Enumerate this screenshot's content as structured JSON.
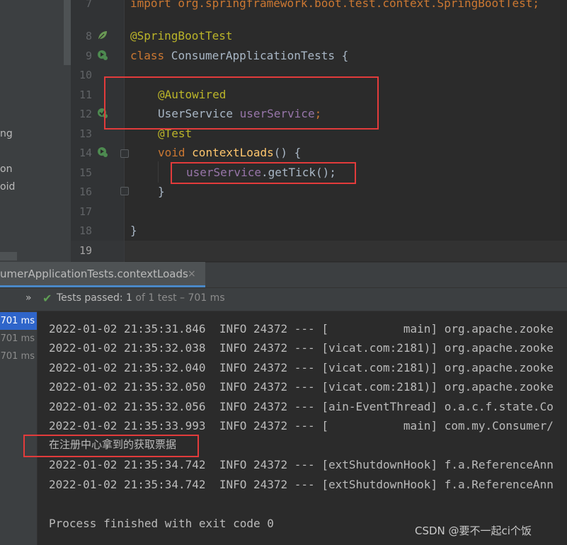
{
  "left_panel": {
    "items": [
      "ng",
      "on",
      "oid"
    ]
  },
  "editor": {
    "lines": [
      {
        "num": "7",
        "text": "import org.springframework.boot.test.context.SpringBootTest;"
      },
      {
        "num": "8",
        "text": "@SpringBootTest"
      },
      {
        "num": "9",
        "kw": "class",
        "rest": " ConsumerApplicationTests {"
      },
      {
        "num": "10"
      },
      {
        "num": "11",
        "text": "@Autowired"
      },
      {
        "num": "12",
        "type": "UserService",
        "field": "userService",
        "end": ";"
      },
      {
        "num": "13",
        "text": "@Test"
      },
      {
        "num": "14",
        "kw": "void",
        "fn": "contextLoads",
        "rest": "() {"
      },
      {
        "num": "15",
        "obj": "userService",
        "rest": ".getTick();"
      },
      {
        "num": "16",
        "text": "}"
      },
      {
        "num": "17"
      },
      {
        "num": "18",
        "text": "}"
      },
      {
        "num": "19"
      }
    ]
  },
  "run_window": {
    "tab_label": "umerApplicationTests.contextLoads",
    "close_glyph": "×",
    "status": {
      "chevrons": "»",
      "check": "✔",
      "passed": "Tests passed: ",
      "count": "1",
      "detail": " of 1 test – 701 ms"
    },
    "tree_times": [
      "701 ms",
      "701 ms",
      "701 ms"
    ],
    "console_lines": [
      "2022-01-02 21:35:31.846  INFO 24372 --- [           main] org.apache.zooke",
      "2022-01-02 21:35:32.038  INFO 24372 --- [vicat.com:2181)] org.apache.zooke",
      "2022-01-02 21:35:32.040  INFO 24372 --- [vicat.com:2181)] org.apache.zooke",
      "2022-01-02 21:35:32.050  INFO 24372 --- [vicat.com:2181)] org.apache.zooke",
      "2022-01-02 21:35:32.056  INFO 24372 --- [ain-EventThread] o.a.c.f.state.Co",
      "2022-01-02 21:35:33.993  INFO 24372 --- [           main] com.my.Consumer/",
      "在注册中心拿到的获取票据",
      "2022-01-02 21:35:34.742  INFO 24372 --- [extShutdownHook] f.a.ReferenceAnn",
      "2022-01-02 21:35:34.742  INFO 24372 --- [extShutdownHook] f.a.ReferenceAnn",
      "",
      "Process finished with exit code 0"
    ]
  },
  "watermark": "CSDN @要不一起ci个饭",
  "colors": {
    "keyword": "#cc7832",
    "annotation": "#bbb529",
    "field": "#9876aa",
    "function": "#ffc66d",
    "highlight_box": "#e23b3b",
    "passed_check": "#5f9e54"
  }
}
